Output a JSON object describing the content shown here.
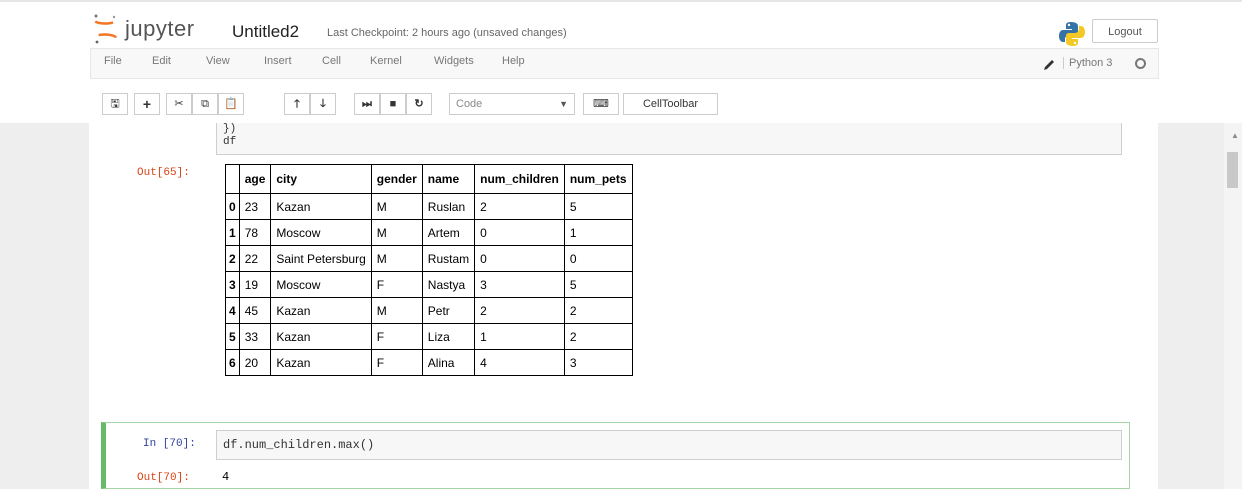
{
  "header": {
    "logo_text": "jupyter",
    "notebook_name": "Untitled2",
    "checkpoint": "Last Checkpoint: 2 hours ago (unsaved changes)",
    "logout": "Logout"
  },
  "menu": [
    "File",
    "Edit",
    "View",
    "Insert",
    "Cell",
    "Kernel",
    "Widgets",
    "Help"
  ],
  "kernel": {
    "name": "Python 3"
  },
  "toolbar": {
    "cell_type": "Code",
    "celltoolbar": "CellToolbar",
    "icons": [
      "save-icon",
      "add-cell-icon",
      "cut-icon",
      "copy-icon",
      "paste-icon",
      "move-up-icon",
      "move-down-icon",
      "run-icon",
      "stop-icon",
      "restart-icon",
      "keyboard-icon"
    ]
  },
  "cell1": {
    "code_line1": "})",
    "code_line2": "df",
    "out_prompt": "Out[65]:",
    "table": {
      "columns": [
        "",
        "age",
        "city",
        "gender",
        "name",
        "num_children",
        "num_pets"
      ],
      "rows": [
        [
          "0",
          "23",
          "Kazan",
          "M",
          "Ruslan",
          "2",
          "5"
        ],
        [
          "1",
          "78",
          "Moscow",
          "M",
          "Artem",
          "0",
          "1"
        ],
        [
          "2",
          "22",
          "Saint Petersburg",
          "M",
          "Rustam",
          "0",
          "0"
        ],
        [
          "3",
          "19",
          "Moscow",
          "F",
          "Nastya",
          "3",
          "5"
        ],
        [
          "4",
          "45",
          "Kazan",
          "M",
          "Petr",
          "2",
          "2"
        ],
        [
          "5",
          "33",
          "Kazan",
          "F",
          "Liza",
          "1",
          "2"
        ],
        [
          "6",
          "20",
          "Kazan",
          "F",
          "Alina",
          "4",
          "3"
        ]
      ]
    }
  },
  "cell2": {
    "in_prompt": "In [70]:",
    "code": "df.num_children.max()",
    "out_prompt": "Out[70]:",
    "output": "4"
  },
  "colors": {
    "out_prompt": "#d84315",
    "in_prompt": "#303f9f",
    "selected_cell_border": "#66bb6a"
  }
}
